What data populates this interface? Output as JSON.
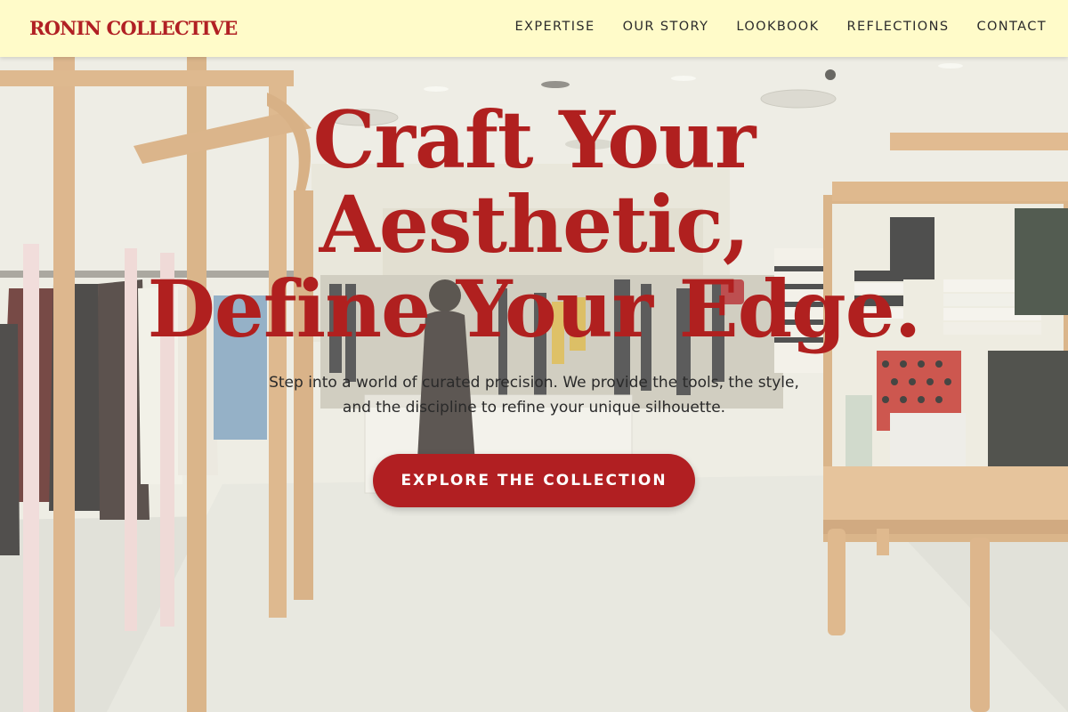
{
  "brand": {
    "name": "RONIN COLLECTIVE",
    "color": "#b12024"
  },
  "header": {
    "background": "#fffbc9"
  },
  "nav": {
    "items": [
      {
        "label": "EXPERTISE"
      },
      {
        "label": "OUR STORY"
      },
      {
        "label": "LOOKBOOK"
      },
      {
        "label": "REFLECTIONS"
      },
      {
        "label": "CONTACT"
      }
    ]
  },
  "hero": {
    "headline_lines": [
      "Craft Your",
      "Aesthetic,",
      "Define Your Edge."
    ],
    "subtitle_lines": [
      "Step into a world of curated precision. We provide the tools, the style,",
      "and the discipline to refine your unique silhouette."
    ],
    "cta_label": "EXPLORE THE COLLECTION",
    "background_image": "clothing-boutique-interior"
  }
}
